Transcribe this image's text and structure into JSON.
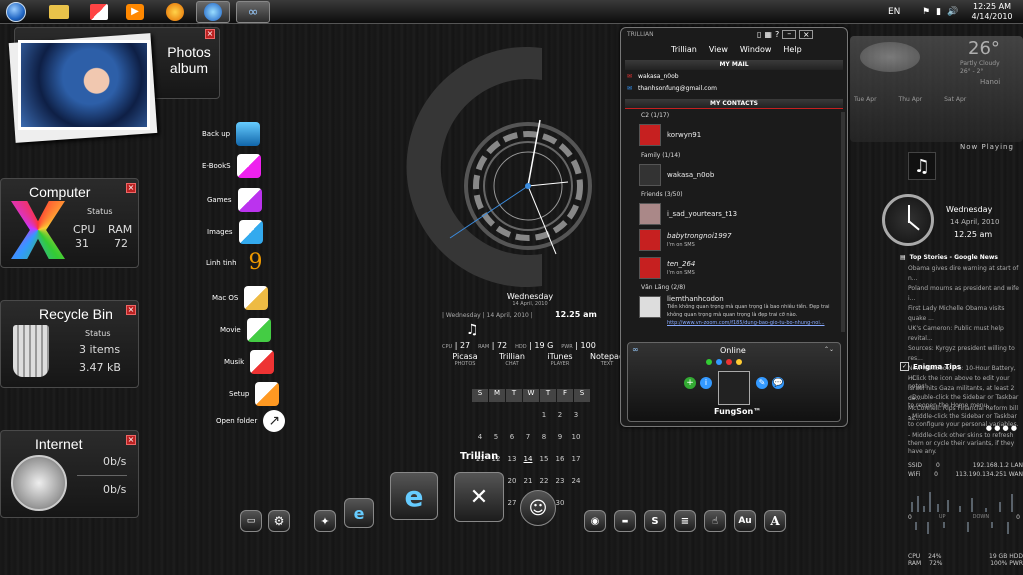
{
  "taskbar": {
    "lang": "EN",
    "time": "12:25 AM",
    "date": "4/14/2010"
  },
  "photos": {
    "title_line1": "Photos",
    "title_line2": "album"
  },
  "computer": {
    "title": "Computer",
    "status": "Status",
    "cpu_label": "CPU",
    "ram_label": "RAM",
    "cpu": "31",
    "ram": "72"
  },
  "recycle": {
    "title": "Recycle Bin",
    "status": "Status",
    "items": "3 items",
    "size": "3.47 kB"
  },
  "internet": {
    "title": "Internet",
    "down": "0b/s",
    "up": "0b/s"
  },
  "dock": {
    "items": [
      "Back up",
      "E-BookS",
      "Games",
      "Images",
      "Linh tinh",
      "Mac OS",
      "Movie",
      "Musik",
      "Setup",
      "Open folder"
    ]
  },
  "clock": {
    "day": "Wednesday",
    "date_short": "14 April, 2010",
    "date_line": "| Wednesday | 14 April, 2010 |",
    "time": "12.25 am"
  },
  "stats": {
    "cpu_label": "CPU",
    "cpu": "27",
    "ram_label": "RAM",
    "ram": "72",
    "hdd_label": "HDD",
    "hdd": "19 G",
    "pwr_label": "PWR",
    "pwr": "100"
  },
  "launch": [
    {
      "name": "Picasa",
      "sub": "PHOTOS"
    },
    {
      "name": "Trillian",
      "sub": "CHAT"
    },
    {
      "name": "iTunes",
      "sub": "PLAYER"
    },
    {
      "name": "Notepad",
      "sub": "TEXT"
    }
  ],
  "calendar": {
    "headers": [
      "S",
      "M",
      "T",
      "W",
      "T",
      "F",
      "S"
    ],
    "rows": [
      [
        "",
        "",
        "",
        "",
        "1",
        "2",
        "3"
      ],
      [
        "4",
        "5",
        "6",
        "7",
        "8",
        "9",
        "10"
      ],
      [
        "11",
        "12",
        "13",
        "14",
        "15",
        "16",
        "17"
      ],
      [
        "18",
        "19",
        "20",
        "21",
        "22",
        "23",
        "24"
      ],
      [
        "25",
        "26",
        "27",
        "28",
        "29",
        "30",
        ""
      ]
    ]
  },
  "trillian": {
    "brand": "TRILLIAN",
    "menu": [
      "Trillian",
      "View",
      "Window",
      "Help"
    ],
    "mail_head": "MY MAIL",
    "mail": [
      "wakasa_n0ob",
      "thanhsonfung@gmail.com"
    ],
    "contacts_head": "MY CONTACTS",
    "groups": [
      {
        "label": "C2 (1/17)"
      },
      {
        "label": "Family (1/14)"
      },
      {
        "label": "Friends (3/50)"
      },
      {
        "label": "Văn Lãng (2/8)"
      }
    ],
    "contacts": [
      {
        "name": "korwyn91",
        "sub": ""
      },
      {
        "name": "wakasa_n0ob",
        "sub": ""
      },
      {
        "name": "i_sad_yourtears_t13",
        "sub": ""
      },
      {
        "name": "babytrongnoi1997",
        "sub": "I'm on SMS"
      },
      {
        "name": "ten_264",
        "sub": "I'm on SMS"
      },
      {
        "name": "liemthanhcodon",
        "sub": "Tiền không quan trọng mà quan trọng là bao nhiêu tiền. Đẹp trai không quan trọng mà quan trọng là đẹp trai cỡ nào."
      }
    ],
    "link": "http://www.vn-zoom.com/f185/dung-bao-gio-tu-bo-nhung-noi...",
    "status": "Online",
    "user": "FungSon™"
  },
  "sidebar": {
    "weather_temp": "26°",
    "weather_sub": "Partly Cloudy",
    "weather_range": "26° - 2°",
    "weather_city": "Hanoi",
    "days": [
      "Tue Apr",
      "Thu Apr",
      "Sat Apr"
    ],
    "now_playing": "Now Playing",
    "day": "Wednesday",
    "date": "14 April, 2010",
    "time": "12.25 am",
    "news_title": "Top Stories - Google News",
    "news": [
      "Obama gives dire warning at start of n...",
      "Poland mourns as president and wife i...",
      "First Lady Michelle Obama visits quake ...",
      "UK's Cameron: Public must help revital...",
      "Sources: Kyrgyz president willing to res...",
      "New MacBook Pro: 10-Hour Battery, Hi...",
      "Israel hits Gaza militants, at least 2 de...",
      "McConnell: Rips Financial Reform bill as..."
    ],
    "tips_title": "Enigma Tips",
    "tips": [
      "- Click the icon above to edit your notes!",
      "- Double-click the Sidebar or Taskbar to reopen the Home menu.",
      "- Middle-click the Sidebar or Taskbar to configure your personal variables.",
      "- Middle-click other skins to refresh them or cycle their variants, if they have any."
    ],
    "net": [
      {
        "k": "SSID",
        "v": "0",
        "ip": "192.168.1.2",
        "t": "LAN"
      },
      {
        "k": "WiFi",
        "v": "0",
        "ip": "113.190.134.251",
        "t": "WAN"
      }
    ],
    "updown": [
      "0",
      "UP",
      "DOWN",
      "0"
    ],
    "sys": [
      {
        "k": "CPU",
        "v": "24%",
        "h": "19 GB",
        "t": "HDD"
      },
      {
        "k": "RAM",
        "v": "72%",
        "h": "100%",
        "t": "PWR"
      }
    ]
  },
  "bottom_label": "Trillian",
  "colors": {
    "accent_red": "#c62020",
    "accent_blue": "#3b8de0"
  }
}
